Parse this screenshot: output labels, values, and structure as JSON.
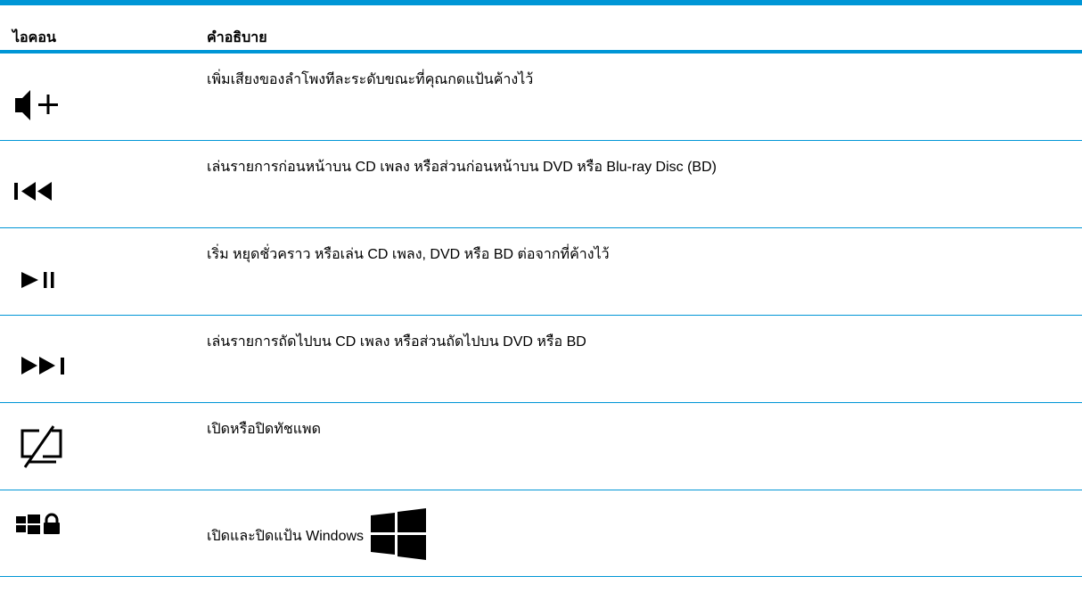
{
  "table": {
    "header": {
      "icon": "ไอคอน",
      "description": "คำอธิบาย"
    },
    "rows": [
      {
        "icon": "volume-up-icon",
        "description": "เพิ่มเสียงของลำโพงทีละระดับขณะที่คุณกดแป้นค้างไว้"
      },
      {
        "icon": "previous-track-icon",
        "description": "เล่นรายการก่อนหน้าบน CD เพลง หรือส่วนก่อนหน้าบน DVD หรือ Blu-ray Disc (BD)"
      },
      {
        "icon": "play-pause-icon",
        "description": "เริ่ม หยุดชั่วคราว หรือเล่น CD เพลง, DVD หรือ BD ต่อจากที่ค้างไว้"
      },
      {
        "icon": "next-track-icon",
        "description": "เล่นรายการถัดไปบน CD เพลง หรือส่วนถัดไปบน DVD หรือ BD"
      },
      {
        "icon": "touchpad-off-icon",
        "description": "เปิดหรือปิดทัชแพด"
      },
      {
        "icon": "windows-lock-icon",
        "description": "เปิดและปิดแป้น Windows",
        "inline_icon": "windows-logo-icon"
      }
    ]
  },
  "colors": {
    "rule": "#0096d6",
    "text": "#000000"
  }
}
